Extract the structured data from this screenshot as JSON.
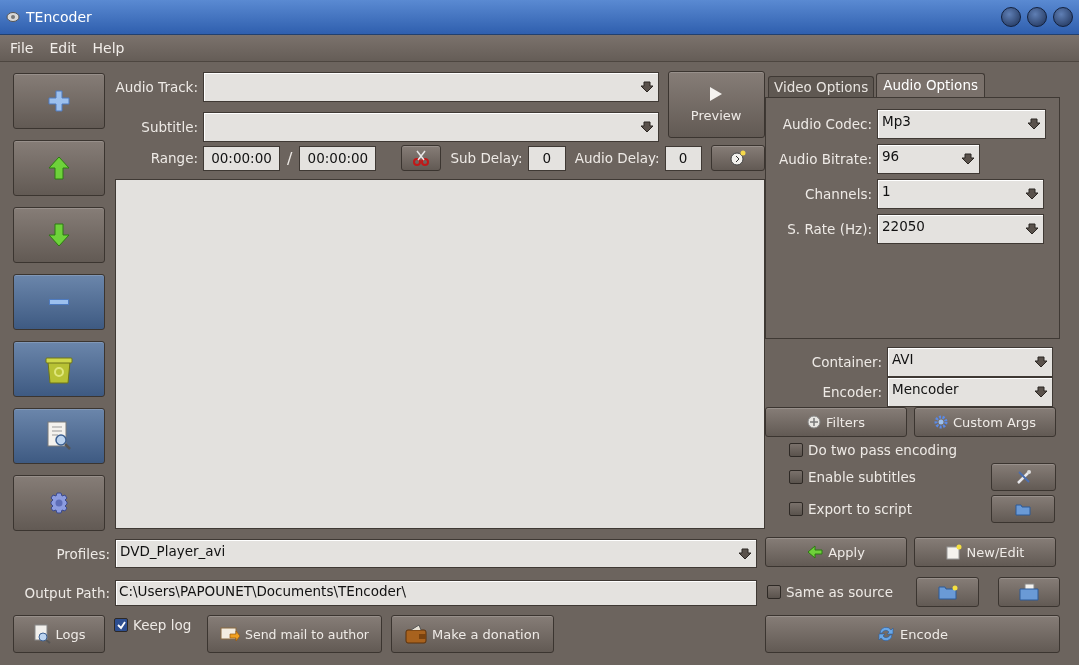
{
  "window": {
    "title": "TEncoder"
  },
  "menu": [
    "File",
    "Edit",
    "Help"
  ],
  "side_buttons": [
    {
      "kind": "add",
      "highlighted": false
    },
    {
      "kind": "up",
      "highlighted": false
    },
    {
      "kind": "down",
      "highlighted": false
    },
    {
      "kind": "remove",
      "highlighted": true
    },
    {
      "kind": "clear",
      "highlighted": true
    },
    {
      "kind": "info",
      "highlighted": true
    },
    {
      "kind": "settings",
      "highlighted": false
    }
  ],
  "audio_track": {
    "label": "Audio Track:"
  },
  "subtitle": {
    "label": "Subtitle:"
  },
  "preview_button": "Preview",
  "range": {
    "label": "Range:",
    "start": "00:00:00",
    "separator": "/",
    "end": "00:00:00"
  },
  "sub_delay": {
    "label": "Sub Delay:",
    "value": "0"
  },
  "audio_delay": {
    "label": "Audio Delay:",
    "value": "0"
  },
  "tabs": [
    {
      "label": "Video Options",
      "selected": false
    },
    {
      "label": "Audio Options",
      "selected": true
    }
  ],
  "audio_options": [
    {
      "label": "Audio Codec:",
      "value": "Mp3"
    },
    {
      "label": "Audio Bitrate:",
      "value": "96"
    },
    {
      "label": "Channels:",
      "value": "1"
    },
    {
      "label": "S. Rate (Hz):",
      "value": "22050"
    }
  ],
  "container": {
    "label": "Container:",
    "value": "AVI"
  },
  "encoder": {
    "label": "Encoder:",
    "value": "Mencoder"
  },
  "filters_button": "Filters",
  "custom_args_button": "Custom Args",
  "options": [
    {
      "label": "Do two pass encoding",
      "checked": false
    },
    {
      "label": "Enable subtitles",
      "checked": false
    },
    {
      "label": "Export to script",
      "checked": false
    }
  ],
  "apply_button": "Apply",
  "new_edit_button": "New/Edit",
  "same_as_source": {
    "label": "Same as source",
    "checked": false
  },
  "encode_button": "Encode",
  "profiles": {
    "label": "Profiles:",
    "value": "DVD_Player_avi"
  },
  "output_path": {
    "label": "Output Path:",
    "value": "C:\\Users\\PAPOUNET\\Documents\\TEncoder\\"
  },
  "logs_button": "Logs",
  "keep_log": {
    "label": "Keep log",
    "checked": true
  },
  "send_mail_button": "Send mail to author",
  "donation_button": "Make a donation"
}
